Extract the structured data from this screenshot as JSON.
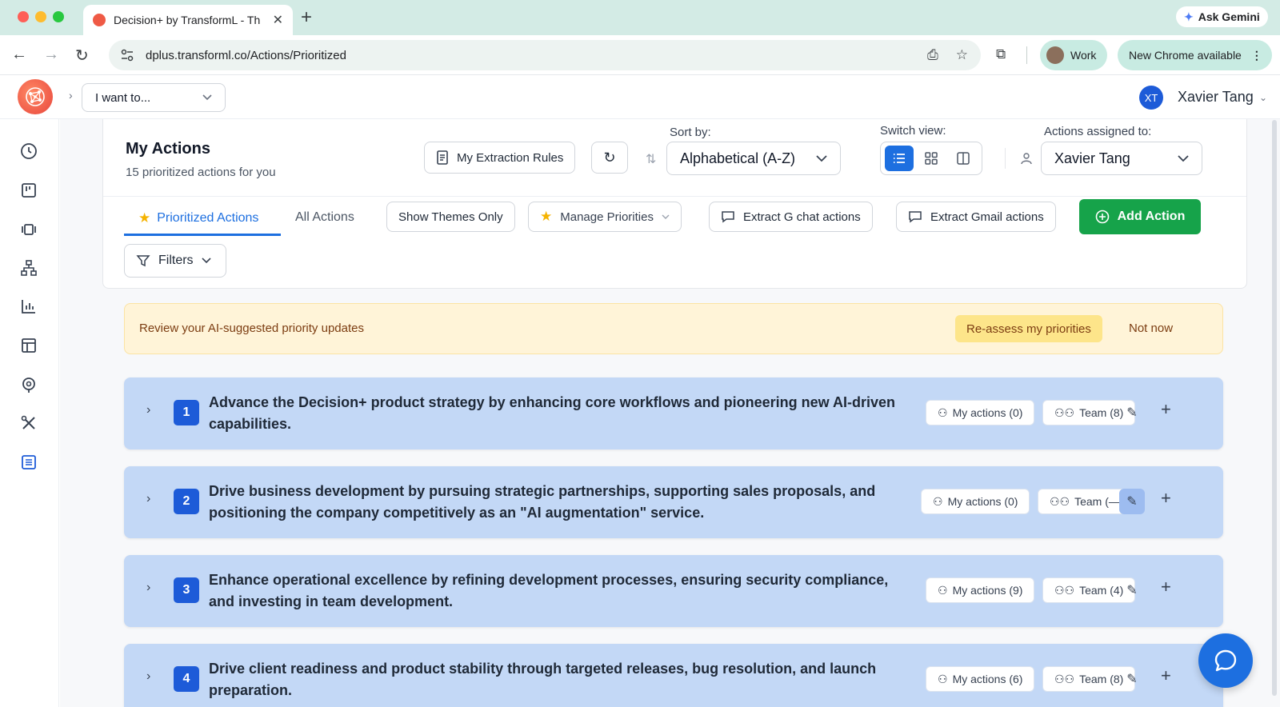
{
  "browser": {
    "tab_title": "Decision+ by TransformL - Th",
    "url": "dplus.transforml.co/Actions/Prioritized",
    "ask_gemini": "Ask Gemini",
    "profile": "Work",
    "update_notice": "New Chrome available"
  },
  "header": {
    "i_want_to": "I want to...",
    "user_initials": "XT",
    "user_name": "Xavier Tang"
  },
  "page": {
    "title": "My Actions",
    "subtitle": "15 prioritized actions for you",
    "extraction_rules": "My Extraction Rules",
    "sort_label": "Sort by:",
    "sort_value": "Alphabetical (A-Z)",
    "view_label": "Switch view:",
    "assigned_label": "Actions assigned to:",
    "assigned_value": "Xavier Tang"
  },
  "tabs": {
    "prioritized": "Prioritized Actions",
    "all": "All Actions",
    "themes_only": "Show Themes Only",
    "manage_priorities": "Manage Priorities",
    "extract_gchat": "Extract G chat actions",
    "extract_gmail": "Extract Gmail actions",
    "add_action": "Add Action",
    "filters": "Filters"
  },
  "banner": {
    "text": "Review your AI-suggested priority updates",
    "reassess": "Re-assess my priorities",
    "not_now": "Not now"
  },
  "colors": {
    "accent": "#1d6fe0",
    "success": "#16a34a",
    "card_bg": "#c3d8f6",
    "banner_bg": "#fff4d8"
  },
  "cards": [
    {
      "number": "1",
      "text": "Advance the Decision+ product strategy by enhancing core workflows and pioneering new AI-driven capabilities.",
      "my_actions": "My actions (0)",
      "team": "Team (8)"
    },
    {
      "number": "2",
      "text": "Drive business development by pursuing strategic partnerships, supporting sales proposals, and positioning the company competitively as an \"AI augmentation\" service.",
      "my_actions": "My actions (0)",
      "team": "Team (—)"
    },
    {
      "number": "3",
      "text": "Enhance operational excellence by refining development processes, ensuring security compliance, and investing in team development.",
      "my_actions": "My actions (9)",
      "team": "Team (4)"
    },
    {
      "number": "4",
      "text": "Drive client readiness and product stability through targeted releases, bug resolution, and launch preparation.",
      "my_actions": "My actions (6)",
      "team": "Team (8)"
    }
  ]
}
